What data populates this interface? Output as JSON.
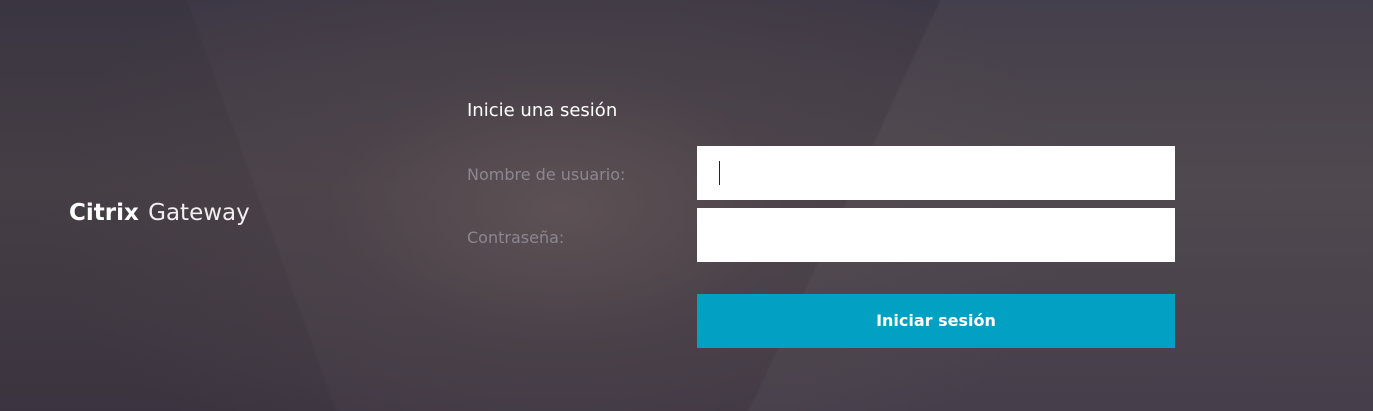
{
  "brand": {
    "strong": "Citrix",
    "light": "Gateway"
  },
  "login": {
    "title": "Inicie una sesión",
    "username_label": "Nombre de usuario:",
    "username_value": "",
    "password_label": "Contraseña:",
    "password_value": "",
    "submit_label": "Iniciar sesión"
  },
  "colors": {
    "accent": "#02a1c4",
    "background": "#463e47",
    "label": "#8d8690"
  }
}
